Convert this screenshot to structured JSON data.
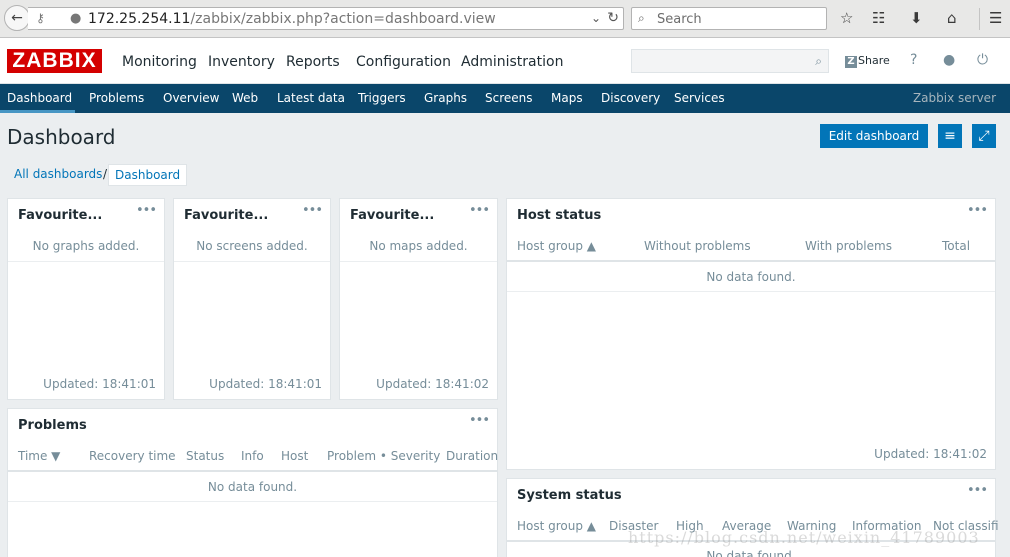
{
  "browser": {
    "url_host": "172.25.254.11",
    "url_path": "/zabbix/zabbix.php?action=dashboard.view",
    "search_placeholder": "Search"
  },
  "header": {
    "logo": "ZABBIX",
    "menu": [
      "Monitoring",
      "Inventory",
      "Reports",
      "Configuration",
      "Administration"
    ],
    "share_label": "Share",
    "help_label": "?"
  },
  "subnav": {
    "items": [
      "Dashboard",
      "Problems",
      "Overview",
      "Web",
      "Latest data",
      "Triggers",
      "Graphs",
      "Screens",
      "Maps",
      "Discovery",
      "Services"
    ],
    "server_name": "Zabbix server"
  },
  "page": {
    "title": "Dashboard",
    "edit_button": "Edit dashboard"
  },
  "breadcrumb": {
    "items": [
      "All dashboards",
      "Dashboard"
    ],
    "separator": "/"
  },
  "widgets": {
    "fav_graphs": {
      "title": "Favourite...",
      "message": "No graphs added.",
      "updated": "Updated: 18:41:01"
    },
    "fav_screens": {
      "title": "Favourite...",
      "message": "No screens added.",
      "updated": "Updated: 18:41:01"
    },
    "fav_maps": {
      "title": "Favourite...",
      "message": "No maps added.",
      "updated": "Updated: 18:41:02"
    },
    "host_status": {
      "title": "Host status",
      "columns": [
        "Host group ▲",
        "Without problems",
        "With problems",
        "Total"
      ],
      "empty": "No data found.",
      "updated": "Updated: 18:41:02"
    },
    "problems": {
      "title": "Problems",
      "columns": [
        "Time ▼",
        "Recovery time",
        "Status",
        "Info",
        "Host",
        "Problem • Severity",
        "Duration"
      ],
      "empty": "No data found."
    },
    "system_status": {
      "title": "System status",
      "columns": [
        "Host group ▲",
        "Disaster",
        "High",
        "Average",
        "Warning",
        "Information",
        "Not classifi"
      ],
      "empty": "No data found."
    },
    "dots": "•••"
  },
  "watermark": "https://blog.csdn.net/weixin_41789003",
  "colors": {
    "brand_red": "#d40000",
    "subnav_bg": "#0a466a",
    "button_blue": "#0275b8"
  }
}
